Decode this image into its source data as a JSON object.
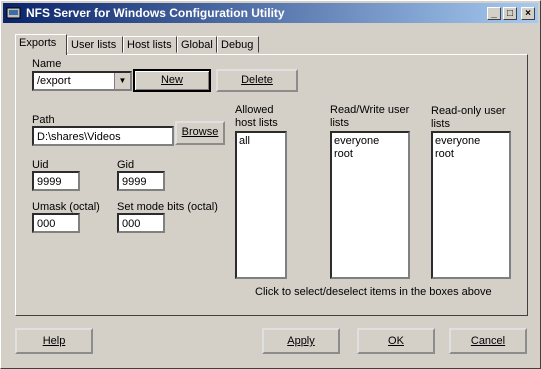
{
  "window": {
    "title": "NFS Server for Windows Configuration Utility"
  },
  "title_buttons": {
    "minimize": "_",
    "maximize": "□",
    "close": "×"
  },
  "tabs": [
    {
      "label": "Exports",
      "active": true
    },
    {
      "label": "User lists",
      "active": false
    },
    {
      "label": "Host lists",
      "active": false
    },
    {
      "label": "Global",
      "active": false
    },
    {
      "label": "Debug",
      "active": false
    }
  ],
  "name": {
    "label": "Name",
    "value": "/export"
  },
  "buttons": {
    "new": "New",
    "delete": "Delete",
    "browse": "Browse",
    "help": "Help",
    "apply": "Apply",
    "ok": "OK",
    "cancel": "Cancel"
  },
  "path": {
    "label": "Path",
    "value": "D:\\shares\\Videos"
  },
  "uid": {
    "label": "Uid",
    "value": "9999"
  },
  "gid": {
    "label": "Gid",
    "value": "9999"
  },
  "umask": {
    "label": "Umask (octal)",
    "value": "000"
  },
  "setmode": {
    "label": "Set mode bits (octal)",
    "value": "000"
  },
  "allowed_hosts": {
    "label_line1": "Allowed",
    "label_line2": "host lists",
    "items": [
      "all"
    ]
  },
  "rw_users": {
    "label_line1": "Read/Write user",
    "label_line2": "lists",
    "items": [
      "everyone",
      "root"
    ]
  },
  "ro_users": {
    "label_line1": "Read-only user",
    "label_line2": "lists",
    "items": [
      "everyone",
      "root"
    ]
  },
  "hint": "Click to select/deselect items in the boxes above"
}
